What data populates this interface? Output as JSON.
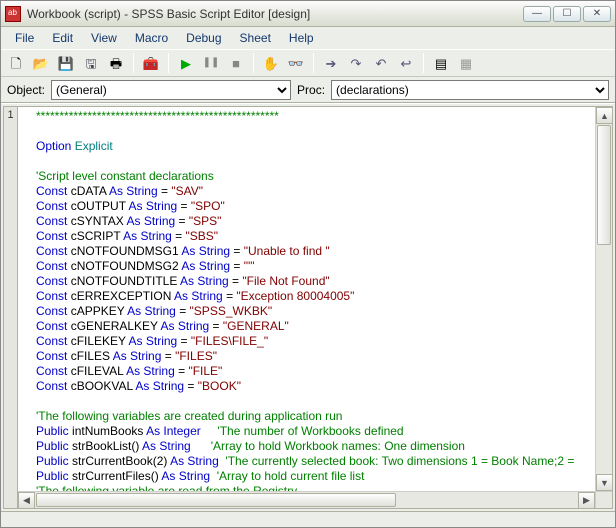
{
  "window": {
    "title": "Workbook (script) - SPSS Basic Script Editor [design]"
  },
  "winctrl": {
    "min": "—",
    "max": "☐",
    "close": "✕"
  },
  "menu": {
    "file": "File",
    "edit": "Edit",
    "view": "View",
    "macro": "Macro",
    "debug": "Debug",
    "sheet": "Sheet",
    "help": "Help"
  },
  "dropdown": {
    "objectLabel": "Object:",
    "objectValue": "(General)",
    "procLabel": "Proc:",
    "procValue": "(declarations)"
  },
  "gutter": {
    "line1": "1"
  },
  "toolbarIcons": {
    "new": "🗋",
    "open": "📂",
    "save": "💾",
    "saveall": "🖫",
    "print": "🖶",
    "toolbox": "🧰",
    "run": "▶",
    "pause": "❚❚",
    "stop": "■",
    "hand": "✋",
    "watch": "👓",
    "stepinto": "➔",
    "stepover": "↷",
    "stepout": "↶",
    "stepback": "↩",
    "dialog": "▤",
    "design": "▦"
  },
  "code": {
    "l1": "****************************************************",
    "l2a": "Option",
    "l2b": " Explicit",
    "l3": "'Script level constant declarations",
    "c1": {
      "kw": "Const",
      "name": " cDATA ",
      "as": "As String",
      "eq": " = ",
      "val": "\"SAV\""
    },
    "c2": {
      "kw": "Const",
      "name": " cOUTPUT ",
      "as": "As String",
      "eq": " = ",
      "val": "\"SPO\""
    },
    "c3": {
      "kw": "Const",
      "name": " cSYNTAX ",
      "as": "As String",
      "eq": " = ",
      "val": "\"SPS\""
    },
    "c4": {
      "kw": "Const",
      "name": " cSCRIPT ",
      "as": "As String",
      "eq": " = ",
      "val": "\"SBS\""
    },
    "c5": {
      "kw": "Const",
      "name": " cNOTFOUNDMSG1 ",
      "as": "As String",
      "eq": " = ",
      "val": "\"Unable to find \""
    },
    "c6": {
      "kw": "Const",
      "name": " cNOTFOUNDMSG2 ",
      "as": "As String",
      "eq": " = ",
      "val": "\"'\""
    },
    "c7": {
      "kw": "Const",
      "name": " cNOTFOUNDTITLE ",
      "as": "As String",
      "eq": " = ",
      "val": "\"File Not Found\""
    },
    "c8": {
      "kw": "Const",
      "name": " cERREXCEPTION ",
      "as": "As String",
      "eq": " = ",
      "val": "\"Exception 80004005\""
    },
    "c9": {
      "kw": "Const",
      "name": " cAPPKEY ",
      "as": "As String",
      "eq": " = ",
      "val": "\"SPSS_WKBK\""
    },
    "c10": {
      "kw": "Const",
      "name": " cGENERALKEY ",
      "as": "As String",
      "eq": " = ",
      "val": "\"GENERAL\""
    },
    "c11": {
      "kw": "Const",
      "name": " cFILEKEY ",
      "as": "As String",
      "eq": " = ",
      "val": "\"FILES\\FILE_\""
    },
    "c12": {
      "kw": "Const",
      "name": " cFILES ",
      "as": "As String",
      "eq": " = ",
      "val": "\"FILES\""
    },
    "c13": {
      "kw": "Const",
      "name": " cFILEVAL ",
      "as": "As String",
      "eq": " = ",
      "val": "\"FILE\""
    },
    "c14": {
      "kw": "Const",
      "name": " cBOOKVAL ",
      "as": "As String",
      "eq": " = ",
      "val": "\"BOOK\""
    },
    "sec2": "'The following variables are created during application run",
    "p1": {
      "kw": "Public",
      "name": " intNumBooks ",
      "as": "As Integer",
      "cmt": "     'The number of Workbooks defined"
    },
    "p2": {
      "kw": "Public",
      "name": " strBookList() ",
      "as": "As String",
      "cmt": "      'Array to hold Workbook names: One dimension"
    },
    "p3": {
      "kw": "Public",
      "name": " strCurrentBook(2) ",
      "as": "As String",
      "cmt": "  'The currently selected book: Two dimensions 1 = Book Name;2 ="
    },
    "p4": {
      "kw": "Public",
      "name": " strCurrentFiles() ",
      "as": "As String",
      "cmt": "  'Array to hold current file list"
    },
    "sec3": "'The following variable are read from the Registry"
  }
}
